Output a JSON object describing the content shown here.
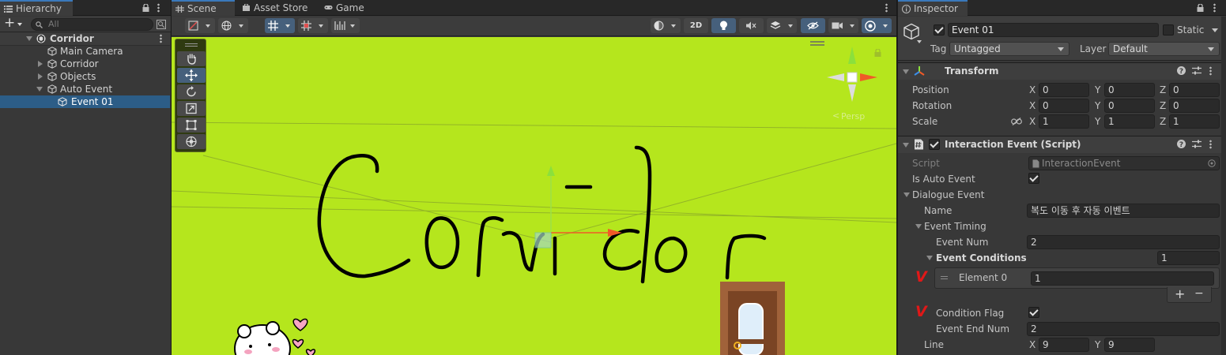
{
  "hierarchy": {
    "tab_label": "Hierarchy",
    "search_placeholder": "All",
    "rows": [
      {
        "label": "Corridor"
      },
      {
        "label": "Main Camera"
      },
      {
        "label": "Corridor"
      },
      {
        "label": "Objects"
      },
      {
        "label": "Auto Event"
      },
      {
        "label": "Event 01"
      }
    ]
  },
  "center_tabs": {
    "scene": "Scene",
    "asset_store": "Asset Store",
    "game": "Game"
  },
  "scene_toolbar": {
    "mode_2d": "2D"
  },
  "scene": {
    "handwritten_text": "Corridor",
    "persp_label": "Persp",
    "colors": {
      "background": "#b5e61d",
      "ink": "#000000",
      "x_axis": "#f05a28",
      "y_axis": "#8be03c"
    }
  },
  "inspector": {
    "tab_label": "Inspector",
    "object_name": "Event 01",
    "static_label": "Static",
    "tag_label": "Tag",
    "tag_value": "Untagged",
    "layer_label": "Layer",
    "layer_value": "Default",
    "transform": {
      "title": "Transform",
      "position_label": "Position",
      "rotation_label": "Rotation",
      "scale_label": "Scale",
      "position": {
        "x": "0",
        "y": "0",
        "z": "0"
      },
      "rotation": {
        "x": "0",
        "y": "0",
        "z": "0"
      },
      "scale": {
        "x": "1",
        "y": "1",
        "z": "1"
      },
      "axis_x": "X",
      "axis_y": "Y",
      "axis_z": "Z"
    },
    "script_component": {
      "title": "Interaction Event (Script)",
      "script_label": "Script",
      "script_value": "InteractionEvent",
      "is_auto_event_label": "Is Auto Event",
      "dialogue_event_label": "Dialogue Event",
      "name_label": "Name",
      "name_value": "복도 이동 후 자동 이벤트",
      "event_timing_label": "Event Timing",
      "event_num_label": "Event Num",
      "event_num_value": "2",
      "event_conditions_label": "Event Conditions",
      "event_conditions_count": "1",
      "element0_label": "Element 0",
      "element0_value": "1",
      "plus": "+",
      "minus": "−",
      "condition_flag_label": "Condition Flag",
      "event_end_num_label": "Event End Num",
      "event_end_num_value": "2",
      "line_label": "Line",
      "line_x": "9",
      "line_y": "9",
      "annotation_mark": "V"
    }
  }
}
